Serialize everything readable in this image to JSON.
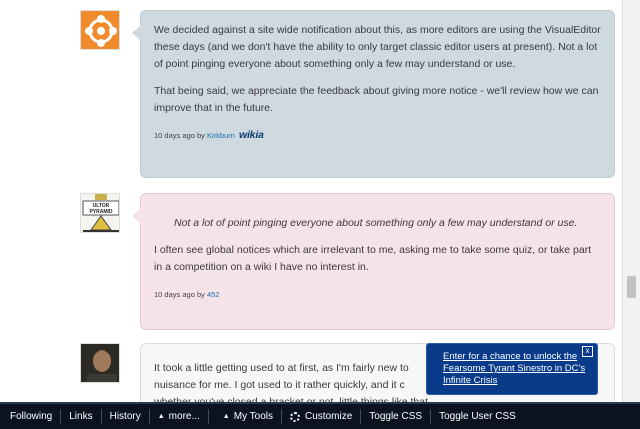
{
  "comments": [
    {
      "paragraphs": [
        "We decided against a site wide notification about this, as more editors are using the VisualEditor these days (and we don't have the ability to only target classic editor users at present). Not a lot of point pinging everyone about something only a few may understand or use.",
        "That being said, we appreciate the feedback about giving more notice - we'll review how we can improve that in the future."
      ],
      "time": "10 days ago by",
      "author": "Kirkburn",
      "staff_badge": "wikia"
    },
    {
      "quote": "Not a lot of point pinging everyone about something only a few may understand or use.",
      "body": "I often see global notices which are irrelevant to me, asking me to take some quiz, or take part in a competition on a wiki I have no interest in.",
      "time": "10 days ago by",
      "author": "452",
      "avatar_text": "ULTOR PYRAMID"
    },
    {
      "body_lines": [
        "It took a little getting used to at first, as I'm fairly new to",
        "nuisance for me.  I got used to it rather quickly, and it c",
        "whether you've closed a bracket or not, little things like that"
      ]
    }
  ],
  "popup": {
    "link": "Enter for a chance to unlock the Fearsome Tyrant Sinestro in DC's Infinite Crisis",
    "close": "x"
  },
  "toolbar": {
    "following": "Following",
    "links": "Links",
    "history": "History",
    "more": "more...",
    "my_tools": "My Tools",
    "customize": "Customize",
    "toggle_css": "Toggle CSS",
    "toggle_user_css": "Toggle User CSS"
  }
}
